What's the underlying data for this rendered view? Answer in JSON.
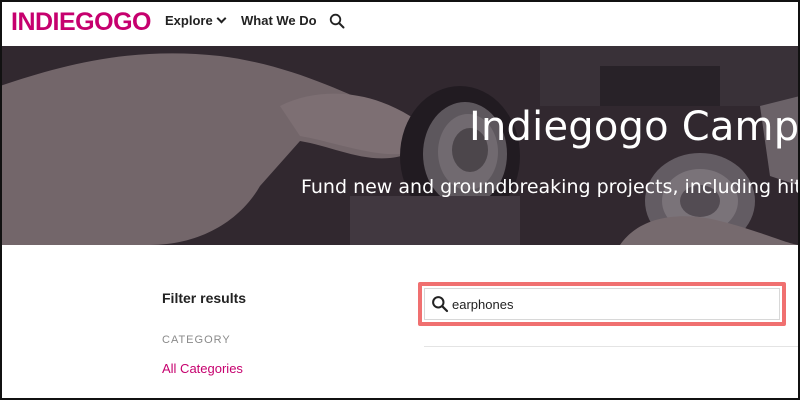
{
  "header": {
    "logo": "INDIEGOGO",
    "nav": {
      "explore_label": "Explore",
      "what_we_do_label": "What We Do"
    },
    "search_icon": "search-icon"
  },
  "hero": {
    "title": "Indiegogo Campai",
    "subtitle": "Fund new and groundbreaking projects, including hits f"
  },
  "filters": {
    "title": "Filter results",
    "category_heading": "CATEGORY",
    "all_categories": "All Categories"
  },
  "search": {
    "value": "earphones",
    "icon": "search-icon"
  },
  "colors": {
    "brand": "#c6006e",
    "highlight": "#f07070"
  }
}
